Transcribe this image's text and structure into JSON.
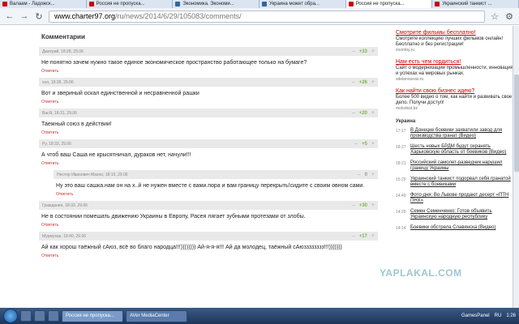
{
  "browser": {
    "tabs": [
      {
        "label": "Валаам - Ладожск...",
        "color": "#c00"
      },
      {
        "label": "Россия не пропуска...",
        "color": "#c00"
      },
      {
        "label": "Экономика. Экономи...",
        "color": "#369"
      },
      {
        "label": "Украина может обра...",
        "color": "#369"
      },
      {
        "label": "Россия не пропуска...",
        "color": "#c00"
      },
      {
        "label": "Украинский танкист ...",
        "color": "#c00"
      }
    ],
    "url_host": "www.charter97.org",
    "url_path": "/ru/news/2014/6/29/105083/comments/",
    "back": "←",
    "forward": "→",
    "reload": "↻"
  },
  "comments_heading": "Комментарии",
  "reply_label": "Ответить",
  "comments": [
    {
      "meta": "Дмитрий, 18:28, 29.06",
      "score": "+33",
      "text": "Не понятно зачем нужно такое единое экономическое пространство работающее только на бумаге?",
      "nested": false
    },
    {
      "meta": "хол, 18:28, 29.06",
      "score": "+26",
      "text": "Вот и звериный оскал единственной и несравненной рашки",
      "nested": false
    },
    {
      "meta": "ВасЯ, 18:31, 29.06",
      "score": "+20",
      "text": "Таежный союз в действии!",
      "nested": false
    },
    {
      "meta": "Ру, 18:33, 29.06",
      "score": "+5",
      "text": "А чтоб ваш Саша не крысятничал, дураков нет, начули!!!",
      "nested": false
    },
    {
      "meta": "Нестор Иванович Махно, 18:15, 29.06",
      "score": "0",
      "text": "Ну это ваш сашка.нам он на х..й не нужен вместе с вами.пора и вам границу перекрыть!сидите с своим овном сами.",
      "nested": true
    },
    {
      "meta": "Гражданин, 18:33, 29.06",
      "score": "+30",
      "text": "Не в состоянии помешать движению Украины в Европу, Расея лягает зубными протезами от злобы.",
      "nested": false
    },
    {
      "meta": "Мурмухан, 18:40, 29.06",
      "score": "+17",
      "text": "Ай как хорош таёжный сАюз, всё во благо народца!!!)))))))) Ай-я-я-я!!! Ай да молодец, таёжный сАюзззззззз!!!)))))))",
      "nested": false
    }
  ],
  "ads": [
    {
      "title": "Смотрите фильмы бесплатно!",
      "body": "Смотрите коллекцию лучших фильмов онлайн! Бесплатно и без регистрации!",
      "url": "zoomby.ru"
    },
    {
      "title": "Нам есть чем гордиться!",
      "body": "Сайт о модернизации промышленности, инновациях и успехах на мировых рынках.",
      "url": "sdelanounas.ru"
    },
    {
      "title": "Как найти свою бизнес идею?",
      "body": "Более 500 видео о том, как найти и развивать свое дело. Получи доступ!",
      "url": "molodost.bz"
    }
  ],
  "feed_title": "Украина",
  "feed": [
    {
      "time": "17:17",
      "text": "В Донецке боевики захватили завод для производства гранат (Видео)"
    },
    {
      "time": "18:27",
      "text": "Шесть новых БРДМ будут охранять Харьковскую область от боевиков (Видео)"
    },
    {
      "time": "18:21",
      "text": "Российский самолет-разведчик нарушил границу Украины"
    },
    {
      "time": "15:29",
      "text": "Украинский танкист подорвал себя гранатой вместе с боевиками"
    },
    {
      "time": "14:49",
      "text": "Фото дня: Во Львове продают десерт «ПТН ПНХ»"
    },
    {
      "time": "14:29",
      "text": "Семен Семенченко: Готов объявить Украинскую народную республику"
    },
    {
      "time": "14:14",
      "text": "Боевики обстрела Славянска (Видео)"
    }
  ],
  "taskbar": {
    "tasks": [
      {
        "label": "Россия не пропуска...",
        "active": true
      },
      {
        "label": "AVer MediaCenter",
        "active": false
      }
    ],
    "tray_label": "GamesPanel",
    "lang": "RU",
    "clock": "1:26"
  },
  "watermark": "YAPLAKAL.COM"
}
